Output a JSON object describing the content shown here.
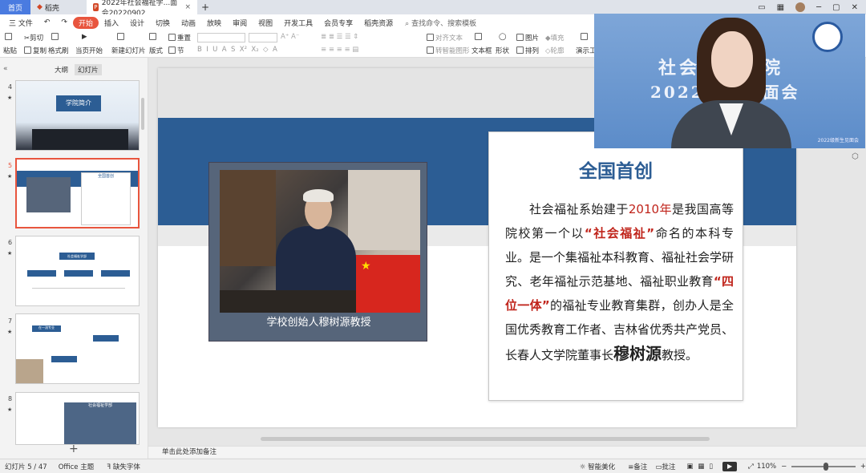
{
  "titlebar": {
    "home_tab": "首页",
    "daoke_tab": "稻壳",
    "doc_tab": "2022年社会福祉学...面会20220902",
    "add_tab": "+",
    "close_glyph": "×"
  },
  "menu": {
    "file": "三 文件",
    "items": [
      "开始",
      "插入",
      "设计",
      "切换",
      "动画",
      "放映",
      "审阅",
      "视图",
      "开发工具",
      "会员专享",
      "稻壳资源"
    ],
    "search": "查找命令、搜索模板"
  },
  "ribbon": {
    "paste": "粘贴",
    "cut": "剪切",
    "copy": "复制",
    "format_painter": "格式刷",
    "from_current": "当页开始",
    "new_slide": "新建幻灯片",
    "layout": "版式",
    "section": "节",
    "reset": "重置",
    "text_box": "文本框",
    "shape": "形状",
    "arrange": "排列",
    "picture": "图片",
    "fill": "填充",
    "outline": "轮廓",
    "align_text": "对齐文本",
    "smartart": "转智能图形",
    "present": "演示工具"
  },
  "left_panel": {
    "tab_outline": "大纲",
    "tab_slides": "幻灯片",
    "slides": [
      {
        "num": "4",
        "title": "学院简介"
      },
      {
        "num": "5",
        "title": "全国首创"
      },
      {
        "num": "6",
        "title": "社会福祉学部"
      },
      {
        "num": "7",
        "title": "在一流专业"
      },
      {
        "num": "8",
        "title": "社会福祉学部"
      }
    ]
  },
  "slide": {
    "caption": "学校创始人穆树源教授",
    "card_title": "全国首创",
    "body_p1": "社会福祉系始建于",
    "body_year": "2010年",
    "body_p2": "是我国高等院校第一个以",
    "body_quote": "“社会福祉”",
    "body_p3": "命名的本科专业。是一个集福祉本科教育、福祉社会学研究、老年福祉示范基地、福祉职业教育",
    "body_quote2": "“四位一体”",
    "body_p4": "的福祉专业教育集群，创办人是全国优秀教育工作者、吉林省优秀共产党员、长春人文学院董事长",
    "body_name": "穆树源",
    "body_end": "教授。"
  },
  "video": {
    "line1": "社会福祉学院",
    "line2": "2022",
    "line2b": "见面会",
    "caption": "2022级新生见面会"
  },
  "notes": {
    "placeholder": "单击此处添加备注"
  },
  "status": {
    "slide_info": "幻灯片 5 / 47",
    "theme": "Office 主题",
    "missing_font": "缺失字体",
    "beautify": "智能美化",
    "notes": "备注",
    "comments": "批注",
    "zoom": "110%"
  }
}
